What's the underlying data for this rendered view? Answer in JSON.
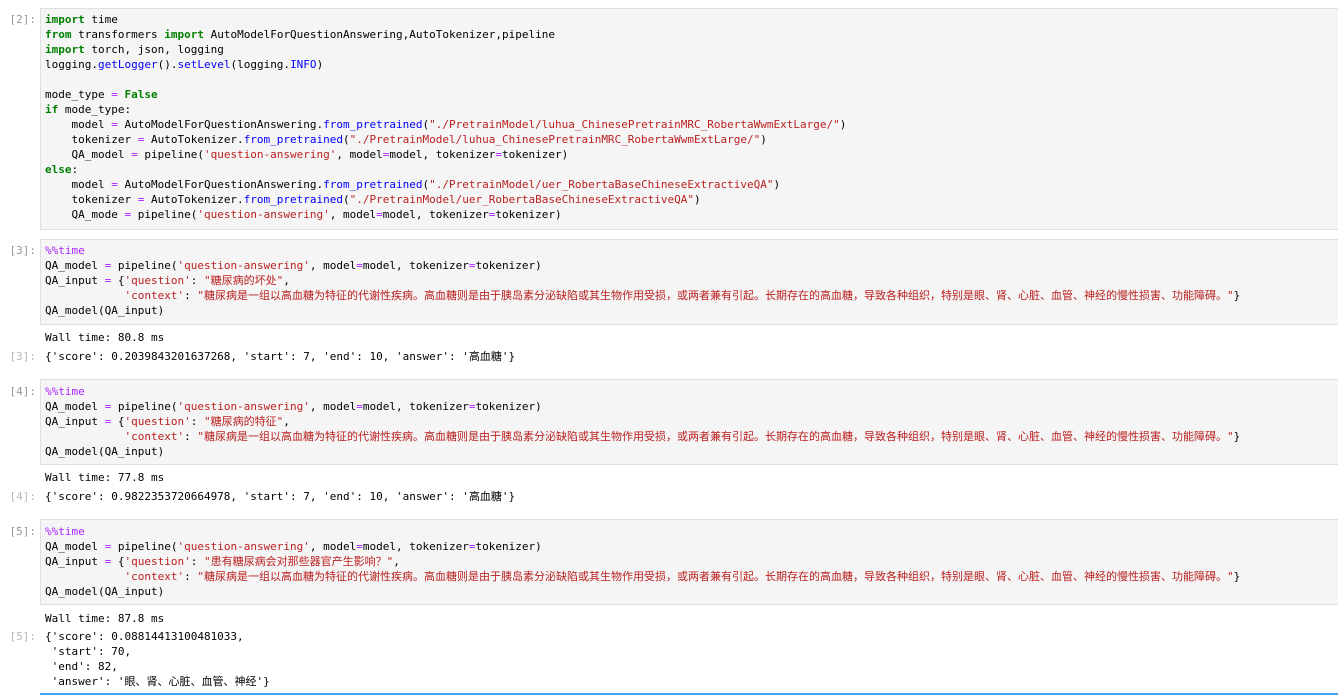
{
  "cells": [
    {
      "in_prompt": "[2]:",
      "code": [
        "import time",
        "from transformers import AutoModelForQuestionAnswering,AutoTokenizer,pipeline",
        "import torch, json, logging",
        "logging.getLogger().setLevel(logging.INFO)",
        "",
        "mode_type = False",
        "if mode_type:",
        "    model = AutoModelForQuestionAnswering.from_pretrained(\"./PretrainModel/luhua_ChinesePretrainMRC_RobertaWwmExtLarge/\")",
        "    tokenizer = AutoTokenizer.from_pretrained(\"./PretrainModel/luhua_ChinesePretrainMRC_RobertaWwmExtLarge/\")",
        "    QA_model = pipeline('question-answering', model=model, tokenizer=tokenizer)",
        "else:",
        "    model = AutoModelForQuestionAnswering.from_pretrained(\"./PretrainModel/uer_RobertaBaseChineseExtractiveQA\")",
        "    tokenizer = AutoTokenizer.from_pretrained(\"./PretrainModel/uer_RobertaBaseChineseExtractiveQA\")",
        "    QA_mode = pipeline('question-answering', model=model, tokenizer=tokenizer)"
      ]
    },
    {
      "in_prompt": "[3]:",
      "code": [
        "%%time",
        "QA_model = pipeline('question-answering', model=model, tokenizer=tokenizer)",
        "QA_input = {'question': \"糖尿病的坏处\",",
        "            'context': \"糖尿病是一组以高血糖为特征的代谢性疾病。高血糖则是由于胰岛素分泌缺陷或其生物作用受损，或两者兼有引起。长期存在的高血糖，导致各种组织，特别是眼、肾、心脏、血管、神经的慢性损害、功能障碍。\"}",
        "QA_model(QA_input)"
      ],
      "stdout": "Wall time: 80.8 ms",
      "out_prompt": "[3]:",
      "result": [
        "{'score': 0.2039843201637268, 'start': 7, 'end': 10, 'answer': '高血糖'}"
      ]
    },
    {
      "in_prompt": "[4]:",
      "code": [
        "%%time",
        "QA_model = pipeline('question-answering', model=model, tokenizer=tokenizer)",
        "QA_input = {'question': \"糖尿病的特征\",",
        "            'context': \"糖尿病是一组以高血糖为特征的代谢性疾病。高血糖则是由于胰岛素分泌缺陷或其生物作用受损，或两者兼有引起。长期存在的高血糖，导致各种组织，特别是眼、肾、心脏、血管、神经的慢性损害、功能障碍。\"}",
        "QA_model(QA_input)"
      ],
      "stdout": "Wall time: 77.8 ms",
      "out_prompt": "[4]:",
      "result": [
        "{'score': 0.9822353720664978, 'start': 7, 'end': 10, 'answer': '高血糖'}"
      ]
    },
    {
      "in_prompt": "[5]:",
      "code": [
        "%%time",
        "QA_model = pipeline('question-answering', model=model, tokenizer=tokenizer)",
        "QA_input = {'question': \"患有糖尿病会对那些器官产生影响？\",",
        "            'context': \"糖尿病是一组以高血糖为特征的代谢性疾病。高血糖则是由于胰岛素分泌缺陷或其生物作用受损，或两者兼有引起。长期存在的高血糖，导致各种组织，特别是眼、肾、心脏、血管、神经的慢性损害、功能障碍。\"}",
        "QA_model(QA_input)"
      ],
      "stdout": "Wall time: 87.8 ms",
      "out_prompt": "[5]:",
      "result": [
        "{'score': 0.08814413100481033,",
        " 'start': 70,",
        " 'end': 82,",
        " 'answer': '眼、肾、心脏、血管、神经'}"
      ]
    }
  ],
  "colors": {
    "keyword": "#008000",
    "string": "#ba2121",
    "function": "#0000ff",
    "magic": "#aa22ff",
    "cell_background": "#f5f5f5",
    "selection": "#42a5f5"
  }
}
